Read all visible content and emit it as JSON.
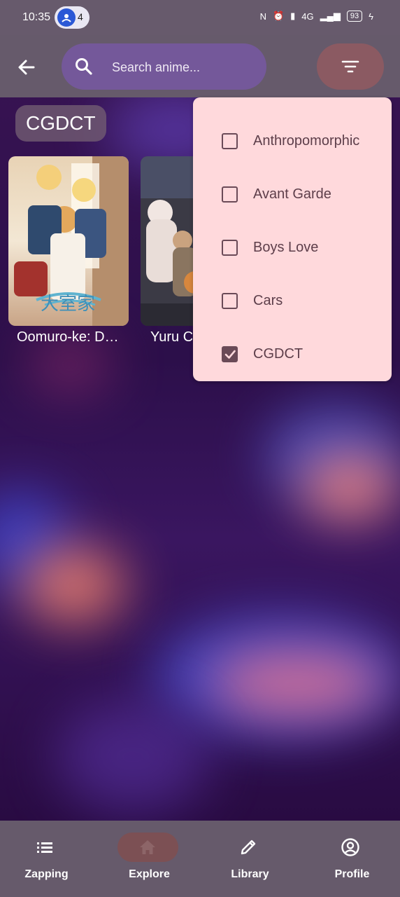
{
  "status_bar": {
    "time": "10:35",
    "notification_count": "4",
    "network": "4G",
    "battery": "93"
  },
  "top_bar": {
    "search_placeholder": "Search anime..."
  },
  "filter_chip": "CGDCT",
  "results": [
    {
      "title": "Oomuro-ke: D…",
      "poster_caption": "大室家"
    },
    {
      "title": "Yuru C"
    }
  ],
  "genre_menu": {
    "items": [
      {
        "label": "Anthropomorphic",
        "checked": false
      },
      {
        "label": "Avant Garde",
        "checked": false
      },
      {
        "label": "Boys Love",
        "checked": false
      },
      {
        "label": "Cars",
        "checked": false
      },
      {
        "label": "CGDCT",
        "checked": true
      }
    ]
  },
  "bottom_nav": {
    "items": [
      {
        "label": "Zapping",
        "icon": "list-icon",
        "active": false
      },
      {
        "label": "Explore",
        "icon": "home-icon",
        "active": true
      },
      {
        "label": "Library",
        "icon": "pencil-icon",
        "active": false
      },
      {
        "label": "Profile",
        "icon": "account-circle-icon",
        "active": false
      }
    ]
  },
  "colors": {
    "bar": "#665a6b",
    "search_fill": "#74589a",
    "filter_fill": "#8b5a62",
    "menu_fill": "#ffd9dc",
    "checkbox": "#6a4a57"
  }
}
